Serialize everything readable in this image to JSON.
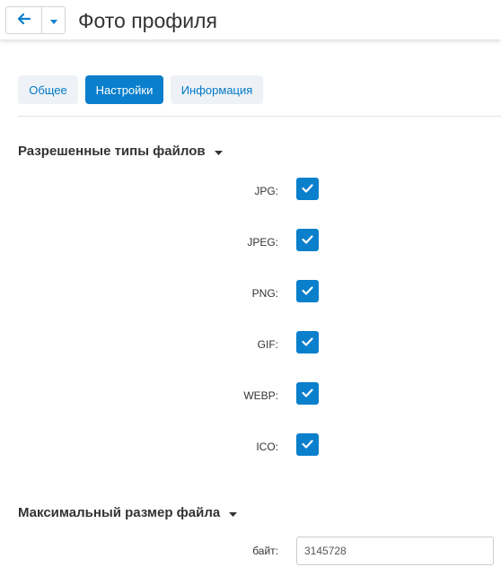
{
  "header": {
    "title": "Фото профиля"
  },
  "tabs": [
    {
      "label": "Общее",
      "active": false
    },
    {
      "label": "Настройки",
      "active": true
    },
    {
      "label": "Информация",
      "active": false
    }
  ],
  "sections": {
    "file_types": {
      "title": "Разрешенные типы файлов",
      "items": [
        {
          "label": "JPG:",
          "checked": true
        },
        {
          "label": "JPEG:",
          "checked": true
        },
        {
          "label": "PNG:",
          "checked": true
        },
        {
          "label": "GIF:",
          "checked": true
        },
        {
          "label": "WEBP:",
          "checked": true
        },
        {
          "label": "ICO:",
          "checked": true
        }
      ]
    },
    "max_size": {
      "title": "Максимальный размер файла",
      "field_label": "байт:",
      "value": "3145728"
    }
  },
  "colors": {
    "accent": "#0a7fcc",
    "tab_inactive_bg": "#eef2f6",
    "tab_inactive_text": "#0078c8"
  }
}
